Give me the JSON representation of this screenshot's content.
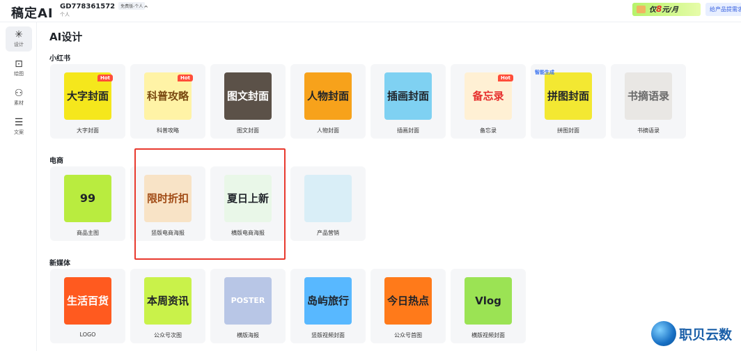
{
  "header": {
    "logo": "稿定AI",
    "account_id": "GD778361572",
    "account_badge": "免费版-个人",
    "account_type": "个人",
    "promo_prefix": "仅",
    "promo_price": "8",
    "promo_suffix": "元/月",
    "gift_label": "给产品提需求"
  },
  "sidebar": {
    "items": [
      {
        "label": "设计",
        "icon": "sparkle-icon",
        "active": true
      },
      {
        "label": "绘图",
        "icon": "image-add-icon",
        "active": false
      },
      {
        "label": "素材",
        "icon": "assets-icon",
        "active": false
      },
      {
        "label": "文案",
        "icon": "text-lines-icon",
        "active": false
      }
    ]
  },
  "page": {
    "title": "AI设计"
  },
  "sections": [
    {
      "title": "小红书",
      "cards": [
        {
          "label": "大字封面",
          "thumb_text": "大字封面",
          "hot": "Hot",
          "colors": [
            "#f5e71c",
            "#1f2329"
          ]
        },
        {
          "label": "科普攻略",
          "thumb_text": "科普攻略",
          "hot": "Hot",
          "colors": [
            "#fff3a6",
            "#7a4a12"
          ]
        },
        {
          "label": "图文封面",
          "thumb_text": "图文封面",
          "hot": "",
          "colors": [
            "#5b5148",
            "#ffffff"
          ]
        },
        {
          "label": "人物封面",
          "thumb_text": "人物封面",
          "hot": "",
          "colors": [
            "#f7a21b",
            "#1f2329"
          ]
        },
        {
          "label": "插画封面",
          "thumb_text": "插画封面",
          "hot": "",
          "colors": [
            "#7fd1f2",
            "#1f2329"
          ]
        },
        {
          "label": "备忘录",
          "thumb_text": "备忘录",
          "hot": "Hot",
          "colors": [
            "#fff0d4",
            "#e6302e"
          ]
        },
        {
          "label": "拼图封面",
          "thumb_text": "拼图封面",
          "hot": "",
          "smart": "智能生成",
          "colors": [
            "#f3e832",
            "#1f2329"
          ]
        },
        {
          "label": "书摘语录",
          "thumb_text": "书摘语录",
          "hot": "",
          "colors": [
            "#e9e7e4",
            "#6a6a6a"
          ]
        }
      ]
    },
    {
      "title": "电商",
      "cards": [
        {
          "label": "商品主图",
          "thumb_text": "99",
          "hot": "",
          "colors": [
            "#b9ec3f",
            "#1f2329"
          ]
        },
        {
          "label": "竖版电商海报",
          "thumb_text": "限时折扣",
          "hot": "",
          "colors": [
            "#f8e3c6",
            "#a04a14"
          ]
        },
        {
          "label": "横版电商海报",
          "thumb_text": "夏日上新",
          "hot": "",
          "colors": [
            "#e9f7e8",
            "#1f2329"
          ]
        },
        {
          "label": "产品营销",
          "thumb_text": "",
          "hot": "",
          "colors": [
            "#d9eef7",
            "#8a9aa8"
          ]
        }
      ]
    },
    {
      "title": "新媒体",
      "cards": [
        {
          "label": "LOGO",
          "thumb_text": "生活百货",
          "hot": "",
          "colors": [
            "#ff5a1f",
            "#ffffff"
          ]
        },
        {
          "label": "公众号次图",
          "thumb_text": "本周资讯",
          "hot": "",
          "colors": [
            "#c9f24a",
            "#1f2329"
          ]
        },
        {
          "label": "横版海报",
          "thumb_text": "POSTER",
          "hot": "",
          "colors": [
            "#b8c6e6",
            "#ffffff"
          ]
        },
        {
          "label": "竖版视频封面",
          "thumb_text": "岛屿旅行",
          "hot": "",
          "colors": [
            "#58b8ff",
            "#1f2329"
          ]
        },
        {
          "label": "公众号首图",
          "thumb_text": "今日热点",
          "hot": "",
          "colors": [
            "#ff7a1a",
            "#1f2329"
          ]
        },
        {
          "label": "横版视频封面",
          "thumb_text": "Vlog",
          "hot": "",
          "colors": [
            "#9be354",
            "#1f2329"
          ]
        }
      ]
    }
  ],
  "watermark": {
    "text": "职贝云数"
  }
}
